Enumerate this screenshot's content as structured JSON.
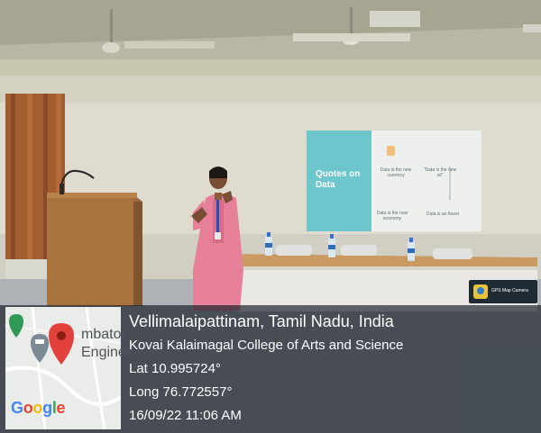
{
  "projection": {
    "title": "Quotes on Data",
    "quotes": [
      "Data is the new currency",
      "\"Data is the new oil\"",
      "Data is the new economy",
      "Data is an Asset"
    ]
  },
  "gps_stamp": {
    "app_name": "GPS Map Camera",
    "location": "Vellimalaipattinam, Tamil Nadu, India",
    "address": "Kovai Kalaimagal College of Arts and Science",
    "latitude": "Lat 10.995724°",
    "longitude": "Long 76.772557°",
    "datetime": "16/09/22 11:06 AM"
  },
  "map_thumbnail": {
    "label_line1": "mbator",
    "label_line2": "Enginee",
    "attribution": "Google",
    "pin_color": "#e2403a"
  },
  "colors": {
    "slide_accent": "#6cc6cc",
    "saree": "#e67f98",
    "overlay": "#1e2630"
  }
}
